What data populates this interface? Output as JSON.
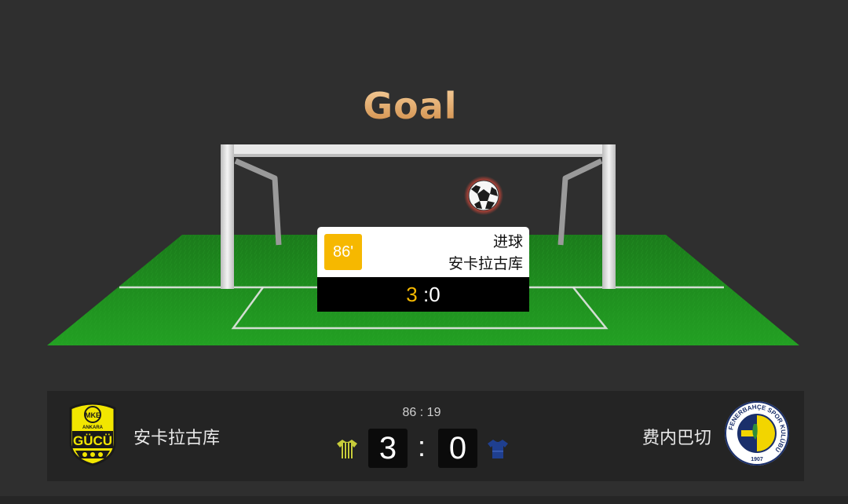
{
  "banner": {
    "title": "Goal"
  },
  "event": {
    "minute": "86'",
    "type": "进球",
    "team": "安卡拉古库",
    "score_home": "3",
    "score_sep": " :",
    "score_away": "0"
  },
  "match": {
    "clock": "86 : 19",
    "home": {
      "name": "安卡拉古库",
      "score": "3",
      "kit_color": "#c7cc3a"
    },
    "away": {
      "name": "费内巴切",
      "score": "0",
      "kit_color": "#1f3f8f"
    },
    "separator": ":"
  },
  "crest_text": {
    "home_top": "MKE",
    "home_arc": "ANKARA",
    "home_mid": "GÜCÜ",
    "away_ring": "FENERBAHÇE SPOR KULÜBÜ",
    "away_year": "1907"
  },
  "colors": {
    "accent": "#f6b800",
    "pitch": "#1f8a1f",
    "background": "#2f2f2f",
    "title": "#e0a062"
  },
  "icons": {
    "ball": "soccer-ball-icon",
    "home_kit": "home-jersey-icon",
    "away_kit": "away-jersey-icon"
  }
}
